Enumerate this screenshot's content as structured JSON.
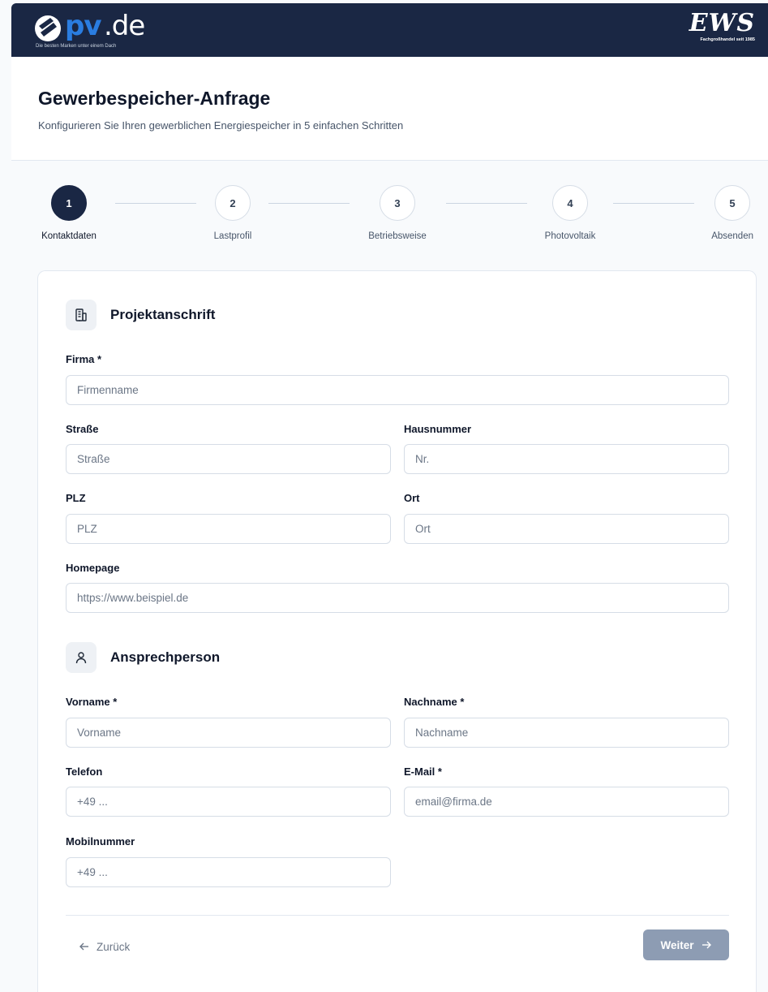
{
  "header": {
    "logo_left": {
      "pv": "pv",
      "de": ".de",
      "tagline": "Die besten Marken unter einem Dach"
    },
    "logo_right": {
      "name": "EWS",
      "tagline": "Fachgroßhandel seit 1985"
    },
    "colors": {
      "background": "#1a2744",
      "pv_blue": "#2a7de1"
    }
  },
  "page": {
    "title": "Gewerbespeicher-Anfrage",
    "subtitle": "Konfigurieren Sie Ihren gewerblichen Energiespeicher in 5 einfachen Schritten"
  },
  "stepper": {
    "active_step": 1,
    "steps": [
      {
        "number": "1",
        "label": "Kontaktdaten"
      },
      {
        "number": "2",
        "label": "Lastprofil"
      },
      {
        "number": "3",
        "label": "Betriebsweise"
      },
      {
        "number": "4",
        "label": "Photovoltaik"
      },
      {
        "number": "5",
        "label": "Absenden"
      }
    ]
  },
  "form": {
    "project_address": {
      "title": "Projektanschrift",
      "icon": "building-icon",
      "company": {
        "label": "Firma *",
        "placeholder": "Firmenname",
        "value": ""
      },
      "street": {
        "label": "Straße",
        "placeholder": "Straße",
        "value": ""
      },
      "house_number": {
        "label": "Hausnummer",
        "placeholder": "Nr.",
        "value": ""
      },
      "zip": {
        "label": "PLZ",
        "placeholder": "PLZ",
        "value": ""
      },
      "city": {
        "label": "Ort",
        "placeholder": "Ort",
        "value": ""
      },
      "homepage": {
        "label": "Homepage",
        "placeholder": "https://www.beispiel.de",
        "value": ""
      }
    },
    "contact_person": {
      "title": "Ansprechperson",
      "icon": "user-icon",
      "first_name": {
        "label": "Vorname *",
        "placeholder": "Vorname",
        "value": ""
      },
      "last_name": {
        "label": "Nachname *",
        "placeholder": "Nachname",
        "value": ""
      },
      "phone": {
        "label": "Telefon",
        "placeholder": "+49 ...",
        "value": ""
      },
      "email": {
        "label": "E-Mail *",
        "placeholder": "email@firma.de",
        "value": ""
      },
      "mobile": {
        "label": "Mobilnummer",
        "placeholder": "+49 ...",
        "value": ""
      }
    }
  },
  "nav": {
    "back_label": "Zurück",
    "next_label": "Weiter",
    "next_color": "#8d9cb3"
  }
}
